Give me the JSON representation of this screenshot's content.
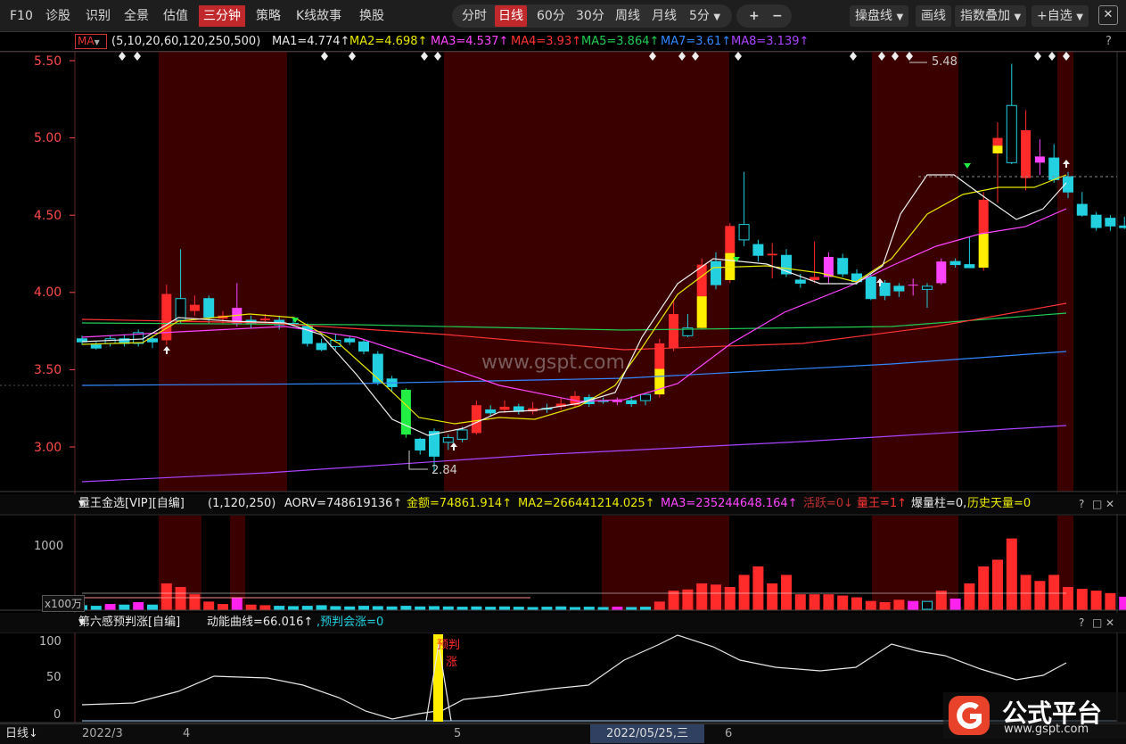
{
  "toolbar": {
    "left_items": [
      "F10",
      "诊股",
      "识别",
      "全景",
      "估值",
      "三分钟",
      "策略",
      "K线故事",
      "换股"
    ],
    "active_left": "三分钟",
    "periods": [
      "分时",
      "日线",
      "60分",
      "30分",
      "周线",
      "月线",
      "5分"
    ],
    "active_period": "日线",
    "plus": "+",
    "minus": "−",
    "pan_line": "操盘线",
    "draw_line": "画线",
    "index_overlay": "指数叠加",
    "add_watch": "+自选",
    "close": "✕"
  },
  "ma_bar": {
    "selector": "MA",
    "params": "(5,10,20,60,120,250,500)",
    "items": [
      {
        "text": "MA1=4.774↑",
        "color": "#e8e8e8"
      },
      {
        "text": "MA2=4.698↑",
        "color": "#e8e800"
      },
      {
        "text": "MA3=4.537↑",
        "color": "#ff44ff"
      },
      {
        "text": "MA4=3.93↑",
        "color": "#ff3333"
      },
      {
        "text": "MA5=3.864↑",
        "color": "#22cc55"
      },
      {
        "text": "MA7=3.61↑",
        "color": "#3388ff"
      },
      {
        "text": "MA8=3.139↑",
        "color": "#aa44ff"
      }
    ],
    "help": "?"
  },
  "main_chart": {
    "y_ticks": [
      "5.50",
      "5.00",
      "4.50",
      "4.00",
      "3.50",
      "3.00"
    ],
    "high_label": "5.48",
    "low_label": "2.84",
    "watermark": "www.gspt.com",
    "colors": {
      "up": "#ff2a2a",
      "down": "#22d0e0",
      "bg_band": "#3a0000",
      "axis": "#ff4a4a"
    }
  },
  "volume_panel": {
    "title": "量王金选[VIP][自编]",
    "params": "(1,120,250)",
    "items": [
      {
        "text": "AORV=748619136↑",
        "color": "#e8e8e8"
      },
      {
        "text": "金额=74861.914↑",
        "color": "#e8e800"
      },
      {
        "text": "MA2=266441214.025↑",
        "color": "#e8e800"
      },
      {
        "text": "MA3=235244648.164↑",
        "color": "#ff44ff"
      },
      {
        "text": "活跃=0↓",
        "color": "#c03030"
      },
      {
        "text": "量王=1↑",
        "color": "#ff3333"
      },
      {
        "text": "爆量柱=0,",
        "color": "#e8e8e8"
      },
      {
        "text": "历史天量=0",
        "color": "#e8e800"
      }
    ],
    "y_tick": "1000",
    "unit": "x100万"
  },
  "sixth_panel": {
    "title": "第六感预判涨[自编]",
    "items": [
      {
        "text": "动能曲线=66.016↑",
        "color": "#e8e8e8"
      },
      {
        "text": ",预判会涨=0",
        "color": "#22d0e0"
      }
    ],
    "y_ticks": [
      "100",
      "50",
      "0"
    ],
    "signal_label_1": "预判",
    "signal_label_2": "涨"
  },
  "bottom_bar": {
    "period": "日线",
    "dates": [
      "2022/3",
      "4",
      "5",
      "6"
    ],
    "cursor_date": "2022/05/25,三"
  },
  "brand": {
    "logo_text": "公式平台",
    "url": "www.gspt.com"
  }
}
